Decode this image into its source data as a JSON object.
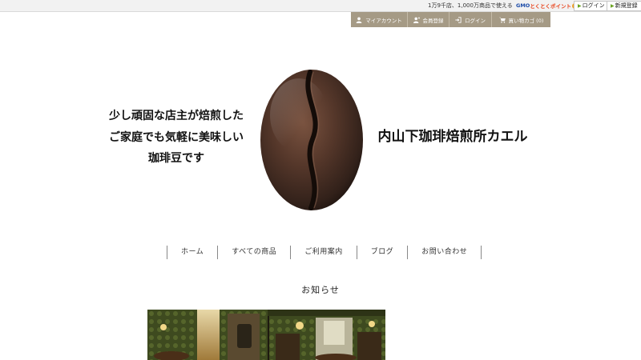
{
  "gmo_bar": {
    "text": "1万9千店、1,000万商品で使える",
    "logo_text_1": "GMO",
    "logo_text_2": "とくとくポイント",
    "login_label": "ログイン",
    "signup_label": "新規登録"
  },
  "header_nav": {
    "items": [
      {
        "label": "マイアカウント",
        "icon": "user-icon"
      },
      {
        "label": "会員登録",
        "icon": "add-user-icon"
      },
      {
        "label": "ログイン",
        "icon": "login-icon"
      },
      {
        "label": "買い物カゴ (0)",
        "icon": "cart-icon"
      }
    ],
    "bg_color": "#a59a85"
  },
  "hero": {
    "tagline_lines": [
      "少し頑固な店主が焙煎した",
      "ご家庭でも気軽に美味しい",
      "珈琲豆です"
    ],
    "shop_name": "内山下珈琲焙煎所カエル"
  },
  "global_nav": {
    "items": [
      "ホーム",
      "すべての商品",
      "ご利用案内",
      "ブログ",
      "お問い合わせ"
    ]
  },
  "news": {
    "heading": "お知らせ"
  }
}
